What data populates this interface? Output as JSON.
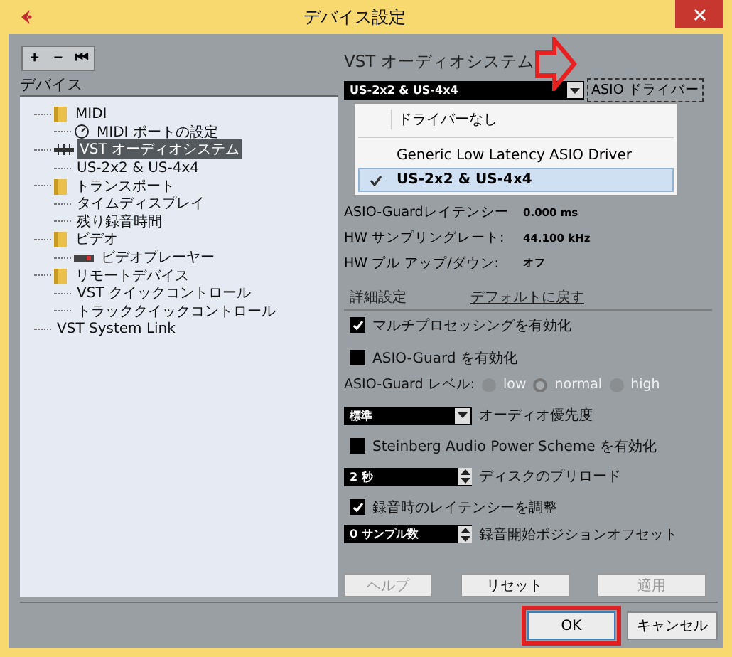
{
  "window": {
    "title": "デバイス設定"
  },
  "toolbar": [
    "+",
    "−",
    "⏮"
  ],
  "tree_header": "デバイス",
  "tree": [
    {
      "label": "MIDI",
      "kind": "folder",
      "selected": false,
      "children": [
        {
          "label": "MIDI ポートの設定",
          "kind": "midi",
          "selected": false
        }
      ]
    },
    {
      "label": "VST オーディオシステム",
      "kind": "audio",
      "selected": true,
      "children": [
        {
          "label": "US-2x2 & US-4x4",
          "kind": "plain",
          "selected": false
        }
      ]
    },
    {
      "label": "トランスポート",
      "kind": "folder",
      "selected": false,
      "children": [
        {
          "label": "タイムディスプレイ",
          "kind": "plain",
          "selected": false
        },
        {
          "label": "残り録音時間",
          "kind": "plain",
          "selected": false
        }
      ]
    },
    {
      "label": "ビデオ",
      "kind": "folder",
      "selected": false,
      "children": [
        {
          "label": "ビデオプレーヤー",
          "kind": "video",
          "selected": false
        }
      ]
    },
    {
      "label": "リモートデバイス",
      "kind": "folder",
      "selected": false,
      "children": [
        {
          "label": "VST クイックコントロール",
          "kind": "plain",
          "selected": false
        },
        {
          "label": "トラッククイックコントロール",
          "kind": "plain",
          "selected": false
        }
      ]
    },
    {
      "label": "VST System Link",
      "kind": "plain",
      "selected": false
    }
  ],
  "panel": {
    "title": "VST オーディオシステム",
    "driver": "US-2x2 & US-4x4",
    "driver_button": "ASIO ドライバー",
    "menu": [
      {
        "label": "ドライバーなし",
        "selected": false
      },
      {
        "label": "Generic Low Latency ASIO Driver",
        "selected": false
      },
      {
        "label": "US-2x2 & US-4x4",
        "selected": true
      }
    ],
    "info": [
      {
        "label": "ASIO-Guardレイテンシー",
        "value": "0.000 ms"
      },
      {
        "label": "HW サンプリングレート:",
        "value": "44.100 kHz"
      },
      {
        "label": "HW プル アップ/ダウン:",
        "value": "オフ"
      }
    ],
    "advanced": "詳細設定",
    "reset_default": "デフォルトに戻す",
    "multiprocessing": {
      "label": "マルチプロセッシングを有効化",
      "checked": true
    },
    "asio_guard": {
      "label": "ASIO-Guard を有効化",
      "checked": false
    },
    "guard_level": {
      "label": "ASIO-Guard レベル:",
      "disabled": true,
      "options": [
        {
          "label": "low",
          "selected": false
        },
        {
          "label": "normal",
          "selected": true
        },
        {
          "label": "high",
          "selected": false
        }
      ]
    },
    "priority": {
      "value": "標準",
      "label": "オーディオ優先度"
    },
    "power_scheme": {
      "label": "Steinberg Audio Power Scheme を有効化",
      "checked": false
    },
    "preload": {
      "value": "2 秒",
      "label": "ディスクのプリロード"
    },
    "latency_adjust": {
      "label": "録音時のレイテンシーを調整",
      "checked": true
    },
    "offset": {
      "value": "0 サンプル数",
      "label": "録音開始ポジションオフセット"
    },
    "buttons": [
      {
        "label": "ヘルプ",
        "disabled": true
      },
      {
        "label": "リセット",
        "disabled": false
      },
      {
        "label": "適用",
        "disabled": true
      }
    ]
  },
  "footer": [
    {
      "label": "OK",
      "highlighted": true
    },
    {
      "label": "キャンセル",
      "highlighted": false
    }
  ]
}
